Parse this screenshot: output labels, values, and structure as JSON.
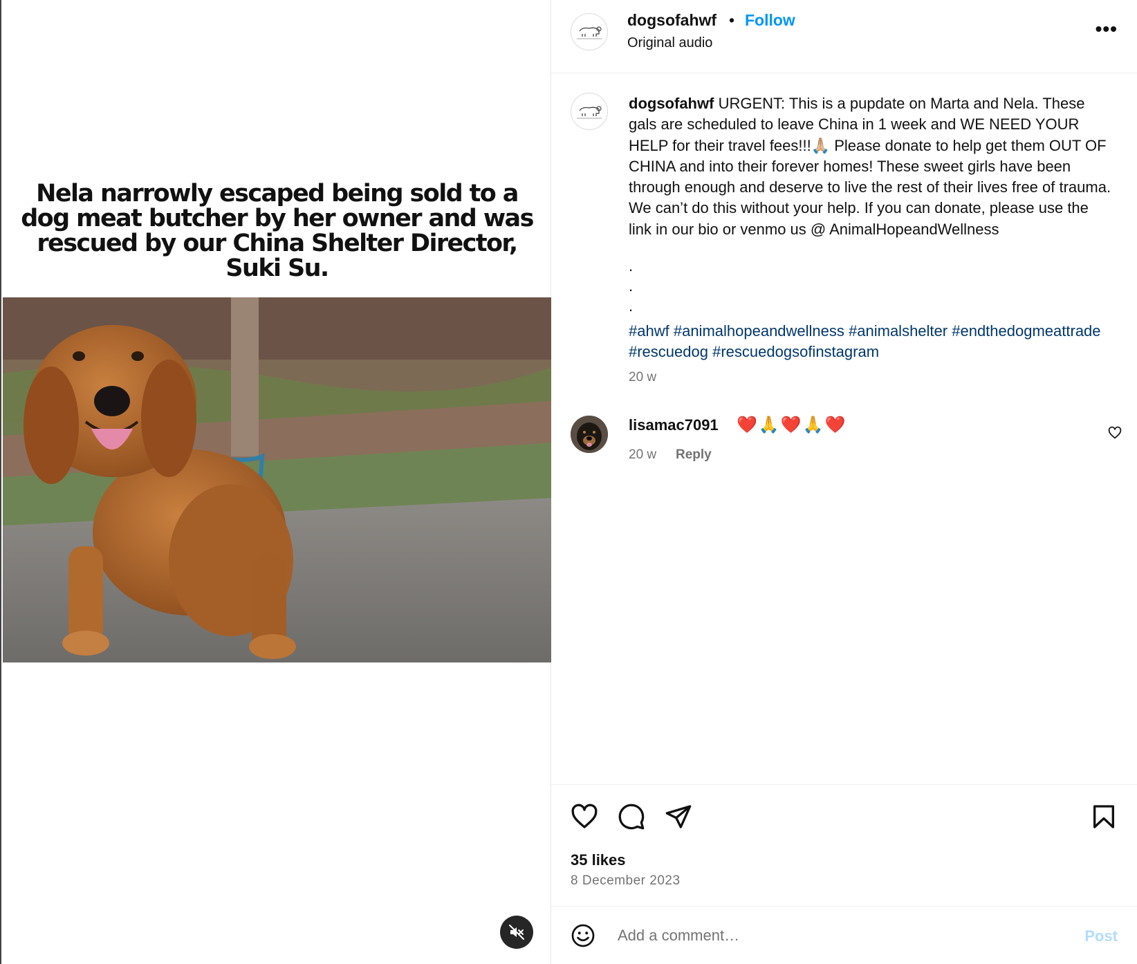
{
  "media": {
    "overlay_text": "Nela narrowly escaped being sold to a dog meat butcher by her owner and was rescued by our China Shelter Director, Suki Su."
  },
  "header": {
    "username": "dogsofahwf",
    "separator": "•",
    "follow_label": "Follow",
    "audio": "Original audio",
    "more_label": "•••"
  },
  "caption": {
    "username": "dogsofahwf",
    "text": "URGENT: This is a pupdate on Marta and Nela. These gals are scheduled to leave China in 1 week and WE NEED YOUR HELP for their travel fees!!!🙏🏼 Please donate to help get them OUT OF CHINA and into their forever homes! These sweet girls have been through enough and deserve to live the rest of their lives free of trauma. We can’t do this without your help. If you can donate, please use the link in our bio or venmo us @ AnimalHopeandWellness",
    "dots": [
      ".",
      ".",
      "."
    ],
    "hashtags": [
      "#ahwf",
      "#animalhopeandwellness",
      "#animalshelter",
      "#endthedogmeattrade",
      "#rescuedog",
      "#rescuedogsofinstagram"
    ],
    "time": "20 w"
  },
  "comment": {
    "username": "lisamac7091",
    "emojis": "❤️🙏❤️🙏❤️",
    "time": "20 w",
    "reply_label": "Reply"
  },
  "stats": {
    "likes": "35 likes",
    "date": "8 December 2023"
  },
  "comment_box": {
    "placeholder": "Add a comment…",
    "post_label": "Post"
  },
  "icons": {
    "like": "heart-icon",
    "comment": "comment-icon",
    "share": "share-icon",
    "save": "bookmark-icon",
    "emoji": "emoji-icon",
    "mute": "speaker-muted-icon"
  },
  "colors": {
    "link_blue": "#0095f6",
    "hashtag": "#00376b",
    "muted_text": "#737373",
    "post_disabled": "#b3dbff"
  }
}
